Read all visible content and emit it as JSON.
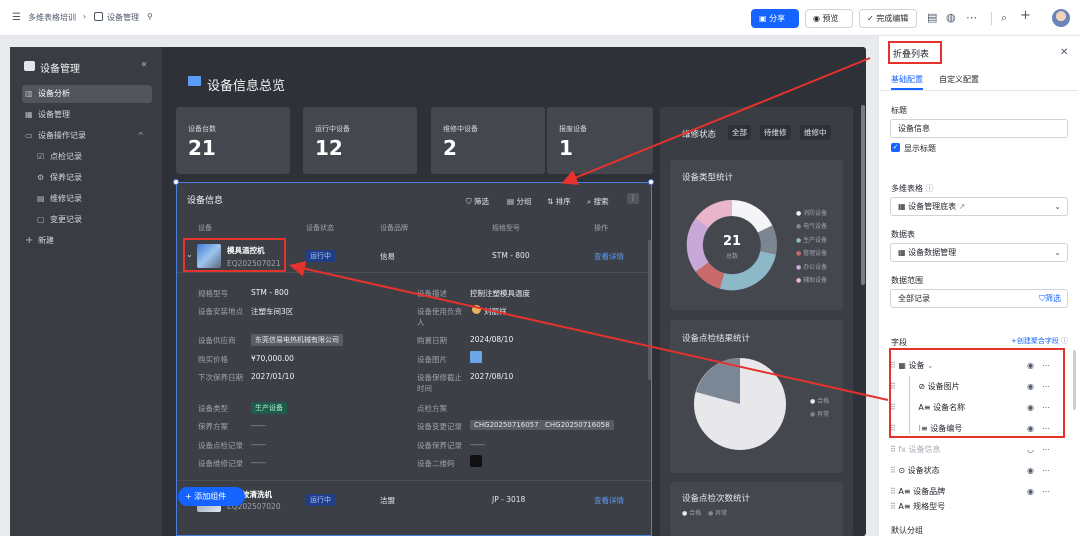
{
  "topbar": {
    "breadcrumb_root": "多维表格培训",
    "breadcrumb_page": "设备管理",
    "share": "分享",
    "preview": "预览",
    "finish_edit": "完成编辑"
  },
  "sidebar": {
    "title": "设备管理",
    "items": [
      {
        "label": "设备分析",
        "icon": "chart-icon"
      },
      {
        "label": "设备管理",
        "icon": "grid-icon"
      },
      {
        "label": "设备操作记录",
        "icon": "folder-icon"
      },
      {
        "label": "点检记录",
        "icon": "check-icon"
      },
      {
        "label": "保养记录",
        "icon": "wrench-icon"
      },
      {
        "label": "维修记录",
        "icon": "doc-icon"
      },
      {
        "label": "变更记录",
        "icon": "calendar-icon"
      }
    ],
    "add": "新建"
  },
  "main": {
    "title": "设备信息总览",
    "stats": [
      {
        "label": "设备台数",
        "value": "21"
      },
      {
        "label": "运行中设备",
        "value": "12"
      },
      {
        "label": "维修中设备",
        "value": "2"
      },
      {
        "label": "报废设备",
        "value": "1"
      }
    ],
    "table": {
      "title": "设备信息",
      "filter": "筛选",
      "group": "分组",
      "sort": "排序",
      "search": "搜索",
      "columns": [
        "设备",
        "设备状态",
        "设备品牌",
        "规格型号",
        "操作"
      ],
      "row1": {
        "name": "模具温控机",
        "code": "EQ202507021",
        "status": "运行中",
        "brand": "信易",
        "model": "STM - 800",
        "action": "查看详情"
      },
      "details": {
        "spec_label": "规格型号",
        "spec": "STM - 800",
        "desc_label": "设备描述",
        "desc": "控制注塑模具温度",
        "loc_label": "设备安装地点",
        "loc": "注塑车间3区",
        "owner_label": "设备使用负责人",
        "owner": "刘丽祥",
        "supplier_label": "设备供应商",
        "supplier": "东莞信易电热机械有限公司",
        "buy_date_label": "购置日期",
        "buy_date": "2024/08/10",
        "price_label": "购买价格",
        "price": "¥70,000.00",
        "img_label": "设备图片",
        "next_label": "下次保养日期",
        "next": "2027/01/10",
        "warranty_label": "设备保修截止时间",
        "warranty": "2027/08/10",
        "type_label": "设备类型",
        "type": "生产设备",
        "plan_label": "点检方案",
        "maint_label": "保养方案",
        "maint": "——",
        "change_label": "设备变更记录",
        "change1": "CHG20250716057",
        "change2": "CHG20250716058",
        "inspect_label": "设备点检记录",
        "inspect": "——",
        "maint_rec_label": "设备保养记录",
        "maint_rec": "——",
        "repair_label": "设备维修记录",
        "repair": "——",
        "qr_label": "设备二维码"
      },
      "row2": {
        "name": "超声波清洗机",
        "code": "EQ202507020",
        "status": "运行中",
        "brand": "洁盟",
        "model": "JP - 3018",
        "action": "查看详情"
      },
      "add_component": "添加组件"
    },
    "right": {
      "maint_label": "维修状态",
      "maint_tabs": [
        "全部",
        "待维修",
        "维修中"
      ],
      "type_title": "设备类型统计",
      "donut_total": "21",
      "donut_sub": "总数",
      "legend": [
        "消防设备",
        "电气设备",
        "生产设备",
        "管理设备",
        "办公设备",
        "辅助设备"
      ],
      "inspect_title": "设备点检结果统计",
      "pie_legend": [
        "合格",
        "异常"
      ],
      "count_title": "设备点检次数统计",
      "count_legend": [
        "合格",
        "异常"
      ]
    }
  },
  "config": {
    "title": "折叠列表",
    "tab_basic": "基础配置",
    "tab_custom": "自定义配置",
    "title_label": "标题",
    "title_value": "设备信息",
    "show_title": "显示标题",
    "table_label": "多维表格",
    "table_value": "设备管理底表",
    "data_label": "数据表",
    "data_value": "设备数据管理",
    "range_label": "数据范围",
    "range_value": "全部记录",
    "filter": "筛选",
    "fields_label": "字段",
    "create_field": "+创建聚合字段",
    "fields": [
      "设备",
      "设备图片",
      "设备名称",
      "设备编号",
      "设备信息",
      "设备状态",
      "设备品牌",
      "规格型号"
    ],
    "default_group": "默认分组"
  }
}
